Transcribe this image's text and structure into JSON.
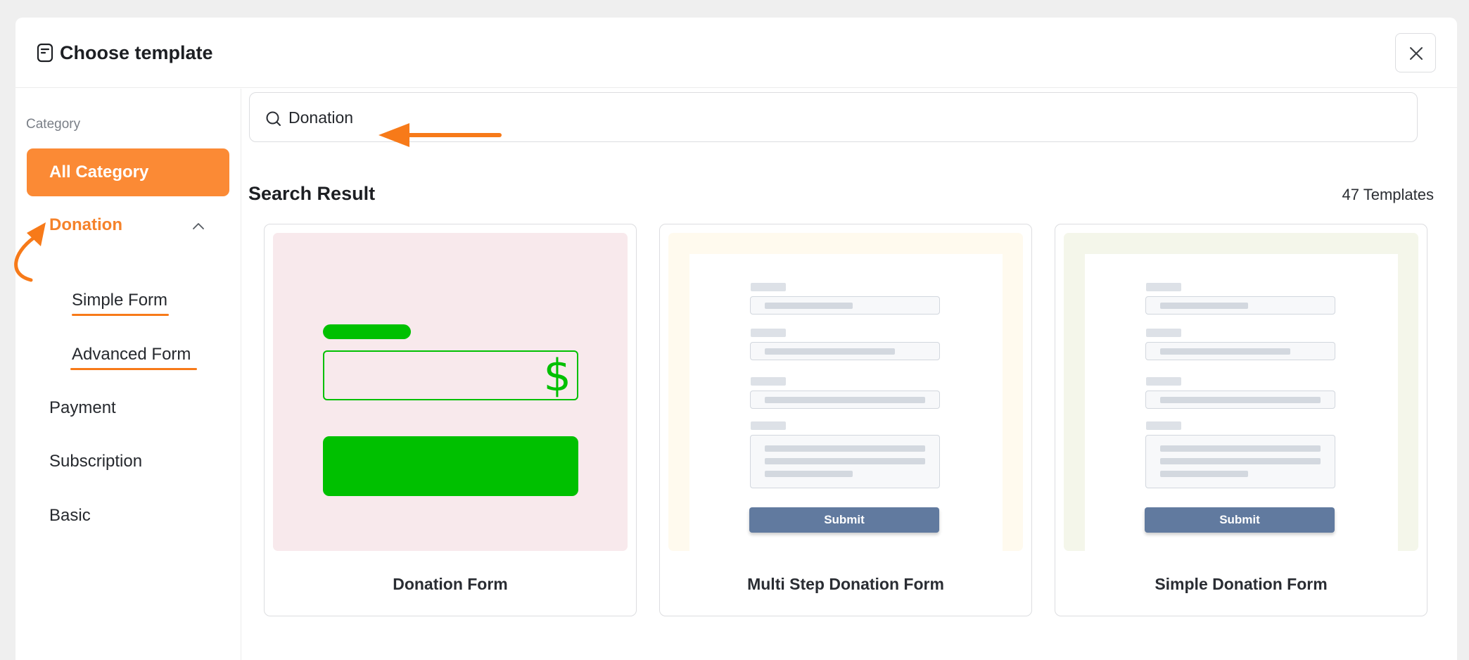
{
  "dialog": {
    "title": "Choose template",
    "title_icon": "template-icon",
    "close_icon": "close-icon"
  },
  "sidebar": {
    "heading": "Category",
    "active": "All Category",
    "groups": [
      {
        "label": "Donation",
        "expanded": true,
        "icon": "chevron-up-icon",
        "children": [
          "Simple Form",
          "Advanced Form"
        ]
      },
      {
        "label": "Payment"
      },
      {
        "label": "Subscription"
      },
      {
        "label": "Basic"
      }
    ]
  },
  "search": {
    "value": "Donation",
    "icon": "search-icon"
  },
  "results": {
    "title": "Search Result",
    "count": "47 Templates"
  },
  "templates": [
    {
      "title": "Donation Form",
      "currency_symbol": "$"
    },
    {
      "title": "Multi Step Donation Form",
      "button": "Submit"
    },
    {
      "title": "Simple Donation Form",
      "button": "Submit"
    }
  ],
  "colors": {
    "accent": "#fb8a35",
    "annotation": "#f77a19",
    "thumb_pink": "#f8e9ec",
    "thumb_cream": "#fffaee",
    "thumb_sage": "#f4f6ea",
    "form_green": "#00c000",
    "submit_blue": "#617a9f"
  }
}
